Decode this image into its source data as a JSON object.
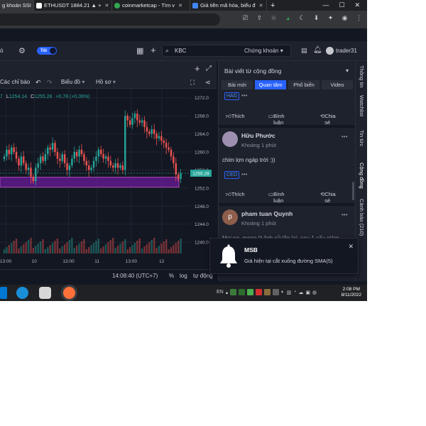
{
  "colors": {
    "background": "#131722",
    "panel": "#1e222d",
    "accent": "#2962ff",
    "candle_up": "#26a69a",
    "candle_down": "#ef5350",
    "support_band": "#7b1fa2",
    "price_tag": "#26a69a"
  },
  "browser": {
    "tabs": [
      {
        "label": "g khoán SSI",
        "favicon": "#1a73e8"
      },
      {
        "label": "ETHUSDT 1884.21 ▲ +",
        "favicon": "#131722"
      },
      {
        "label": "coinmarketcap - Tìm v",
        "favicon": "#34a853"
      },
      {
        "label": "Giá tiền mã hóa, biểu đ",
        "favicon": "#4285f4"
      }
    ],
    "new_tab_label": "+",
    "window_controls": [
      "—",
      "☐",
      "✕"
    ],
    "addr_icons": [
      "cast-icon",
      "share-icon",
      "star-icon",
      "extension-green-icon",
      "moon-icon",
      "download-icon",
      "puzzle-icon",
      "account-icon",
      "menu-icon"
    ]
  },
  "app_header": {
    "language": "ó",
    "theme_toggle": "Tối",
    "search_placeholder": "KBC",
    "market": "Chứng khoán",
    "username": "trader31"
  },
  "chart_toolbar": {
    "indicators": "Các chỉ báo",
    "chart_menu": "Biểu đồ",
    "profile_menu": "Hồ sơ"
  },
  "chart_data": {
    "type": "candlestick",
    "ohlc_legend": {
      "low_label": "L",
      "low": "1254.14",
      "close_label": "C",
      "close": "1255.28",
      "change": "+0.78 (+0.06%)",
      "prefix": "7"
    },
    "y_ticks": [
      1272.0,
      1268.0,
      1264.0,
      1260.0,
      1256.0,
      1252.0,
      1248.0,
      1244.0,
      1240.0
    ],
    "ylim": [
      1237.5,
      1274.0
    ],
    "price_tag": "1255.28",
    "support_band": [
      1252.2,
      1254.4
    ],
    "x_tick_labels": [
      "13:00",
      "10",
      "13:00",
      "11",
      "13:00",
      "12"
    ],
    "x_tick_positions": [
      0.03,
      0.18,
      0.36,
      0.51,
      0.69,
      0.85
    ],
    "closes": [
      1259.0,
      1260.5,
      1259.5,
      1261.0,
      1260.0,
      1258.5,
      1257.0,
      1259.0,
      1257.5,
      1256.0,
      1256.5,
      1254.5,
      1253.5,
      1256.5,
      1257.5,
      1259.0,
      1258.0,
      1259.5,
      1261.0,
      1260.5,
      1262.0,
      1260.0,
      1258.5,
      1258.0,
      1259.5,
      1257.5,
      1256.0,
      1257.0,
      1258.5,
      1260.0,
      1259.0,
      1260.5,
      1259.5,
      1258.0,
      1257.0,
      1256.0,
      1256.5,
      1258.0,
      1259.0,
      1260.5,
      1259.5,
      1258.5,
      1259.0,
      1258.0,
      1257.0,
      1256.5,
      1257.5,
      1256.5,
      1257.0,
      1256.0,
      1268.0,
      1267.0,
      1266.0,
      1267.5,
      1268.5,
      1267.0,
      1266.5,
      1267.0,
      1265.5,
      1264.5,
      1264.0,
      1265.0,
      1264.0,
      1263.0,
      1263.5,
      1262.5,
      1262.0,
      1261.0,
      1260.5,
      1259.0,
      1257.5,
      1255.0,
      1254.0,
      1255.28
    ],
    "timezone": "14:08:40 (UTC+7)",
    "footer_options": [
      "%",
      "log",
      "tự động"
    ]
  },
  "panel": {
    "title": "Bài viết từ cộng đồng",
    "tabs": [
      "Bài mới",
      "Quan tâm",
      "Phổ biến",
      "Video"
    ],
    "active_tab": 1,
    "actions": {
      "like": "Thích",
      "comment": "Bình luận",
      "share": "Chia sẻ"
    },
    "posts": [
      {
        "tag": "HAG"
      },
      {
        "author": "Hữu Phước",
        "time": "Khoảng 1 phút",
        "text": "chim lợn ngáp trời :))",
        "tag": "CEO",
        "avatar_color": "#9e8fb0"
      },
      {
        "author": "pham tuan Quynh",
        "time": "Khoảng 1 phút",
        "text": "Mọi ng, mong là lịch sử lặp lại, sau 1 cấu giảm",
        "avatar_initial": "p",
        "avatar_color": "#8d5e4b"
      }
    ],
    "side_tabs": [
      "Thông tin",
      "Watchlist",
      "Tin tức",
      "Cộng đồng",
      "Cảnh báo (210)"
    ]
  },
  "toast": {
    "title": "MSB",
    "message": "Giá hiện tại cắt xuống đường SMA(5)",
    "close": "✕"
  },
  "taskbar": {
    "language": "EN",
    "time": "2:08 PM",
    "date": "8/11/2022"
  }
}
